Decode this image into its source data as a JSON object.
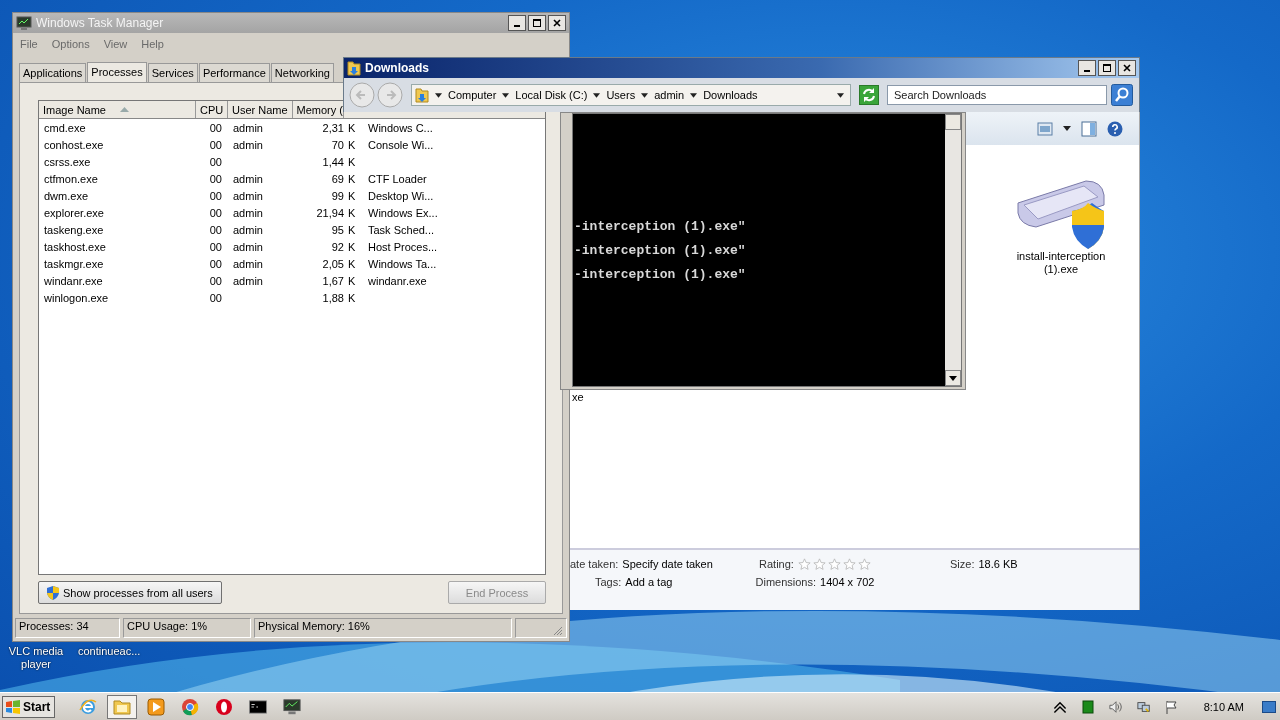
{
  "desktop": {
    "icons": [
      {
        "label": "VLC media player"
      },
      {
        "label": "continueac..."
      }
    ]
  },
  "task_manager": {
    "title": "Windows Task Manager",
    "menu": [
      "File",
      "Options",
      "View",
      "Help"
    ],
    "tabs": [
      {
        "label": "Applications",
        "selected": false
      },
      {
        "label": "Processes",
        "selected": true
      },
      {
        "label": "Services",
        "selected": false
      },
      {
        "label": "Performance",
        "selected": false
      },
      {
        "label": "Networking",
        "selected": false
      }
    ],
    "columns": [
      {
        "label": "Image Name",
        "sorted": true
      },
      {
        "label": "CPU",
        "sorted": false
      },
      {
        "label": "User Name",
        "sorted": false
      },
      {
        "label": "Memory (",
        "sorted": false
      }
    ],
    "rows": [
      {
        "image_name": "cmd.exe",
        "cpu": "00",
        "user_name": "admin",
        "memory": "2,31",
        "column_5": "K",
        "column_6": "Windows C..."
      },
      {
        "image_name": "conhost.exe",
        "cpu": "00",
        "user_name": "admin",
        "memory": "70",
        "column_5": "K",
        "column_6": "Console Wi..."
      },
      {
        "image_name": "csrss.exe",
        "cpu": "00",
        "user_name": "",
        "memory": "1,44",
        "column_5": "K",
        "column_6": ""
      },
      {
        "image_name": "ctfmon.exe",
        "cpu": "00",
        "user_name": "admin",
        "memory": "69",
        "column_5": "K",
        "column_6": "CTF Loader"
      },
      {
        "image_name": "dwm.exe",
        "cpu": "00",
        "user_name": "admin",
        "memory": "99",
        "column_5": "K",
        "column_6": "Desktop Wi..."
      },
      {
        "image_name": "explorer.exe",
        "cpu": "00",
        "user_name": "admin",
        "memory": "21,94",
        "column_5": "K",
        "column_6": "Windows Ex..."
      },
      {
        "image_name": "taskeng.exe",
        "cpu": "00",
        "user_name": "admin",
        "memory": "95",
        "column_5": "K",
        "column_6": "Task Sched..."
      },
      {
        "image_name": "taskhost.exe",
        "cpu": "00",
        "user_name": "admin",
        "memory": "92",
        "column_5": "K",
        "column_6": "Host Proces..."
      },
      {
        "image_name": "taskmgr.exe",
        "cpu": "00",
        "user_name": "admin",
        "memory": "2,05",
        "column_5": "K",
        "column_6": "Windows Ta..."
      },
      {
        "image_name": "windanr.exe",
        "cpu": "00",
        "user_name": "admin",
        "memory": "1,67",
        "column_5": "K",
        "column_6": "windanr.exe"
      },
      {
        "image_name": "winlogon.exe",
        "cpu": "00",
        "user_name": "",
        "memory": "1,88",
        "column_5": "K",
        "column_6": ""
      }
    ],
    "show_all_button": "Show processes from all users",
    "end_process": {
      "label": "End Process",
      "disabled": true
    },
    "status_bar": [
      "Processes: 34",
      "CPU Usage: 1%",
      "Physical Memory: 16%"
    ]
  },
  "explorer": {
    "title": "Downloads",
    "breadcrumbs": [
      "Computer",
      "Local Disk (C:)",
      "Users",
      "admin",
      "Downloads"
    ],
    "search": {
      "placeholder": "Search Downloads"
    },
    "partial_label": "xe",
    "file": {
      "name": "install-interception (1).exe"
    },
    "details": [
      {
        "label": "ate taken:",
        "value": "Specify date taken"
      },
      {
        "label": "Rating:",
        "stars": 0
      },
      {
        "label": "Size:",
        "value": "18.6 KB"
      },
      {
        "label": "Tags:",
        "value": "Add a tag"
      },
      {
        "label": "Dimensions:",
        "value": "1404 x 702"
      }
    ]
  },
  "console": {
    "lines": [
      "-interception (1).exe\"",
      "-interception (1).exe\"",
      "-interception (1).exe\""
    ]
  },
  "taskbar": {
    "start": "Start",
    "apps": [
      {
        "kind": "ie",
        "selected": false
      },
      {
        "kind": "folder",
        "selected": true
      },
      {
        "kind": "media",
        "selected": false
      },
      {
        "kind": "chrome",
        "selected": false
      },
      {
        "kind": "opera",
        "selected": false
      },
      {
        "kind": "cmd",
        "selected": false
      },
      {
        "kind": "taskmgr",
        "selected": false
      }
    ],
    "clock": "8:10 AM"
  }
}
